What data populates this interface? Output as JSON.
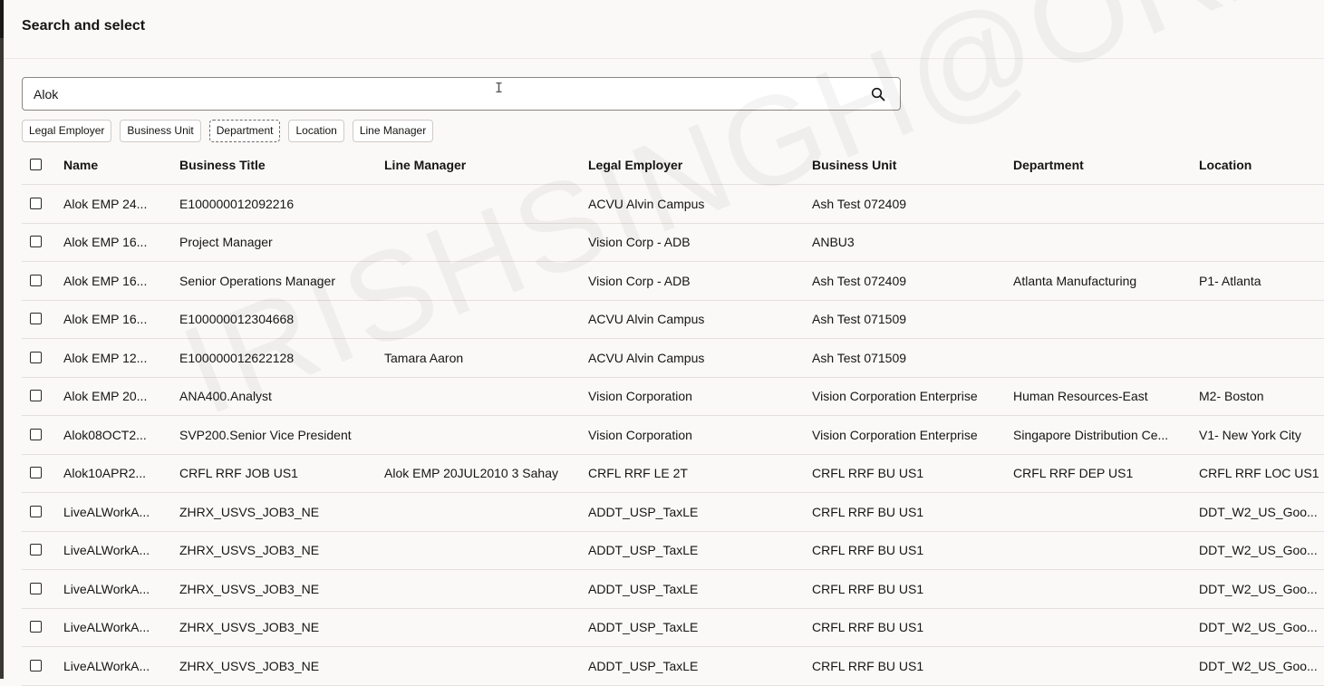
{
  "header": {
    "title": "Search and select"
  },
  "search": {
    "value": "Alok"
  },
  "filters": [
    "Legal Employer",
    "Business Unit",
    "Department",
    "Location",
    "Line Manager"
  ],
  "columns": [
    "Name",
    "Business Title",
    "Line Manager",
    "Legal Employer",
    "Business Unit",
    "Department",
    "Location"
  ],
  "rows": [
    [
      "Alok EMP 24...",
      "E100000012092216",
      "",
      "ACVU Alvin Campus",
      "Ash Test 072409",
      "",
      ""
    ],
    [
      "Alok EMP 16...",
      "Project Manager",
      "",
      "Vision Corp - ADB",
      "ANBU3",
      "",
      ""
    ],
    [
      "Alok EMP 16...",
      "Senior Operations Manager",
      "",
      "Vision Corp - ADB",
      "Ash Test 072409",
      "Atlanta Manufacturing",
      "P1- Atlanta"
    ],
    [
      "Alok EMP 16...",
      "E100000012304668",
      "",
      "ACVU Alvin Campus",
      "Ash Test 071509",
      "",
      ""
    ],
    [
      "Alok EMP 12...",
      "E100000012622128",
      "Tamara Aaron",
      "ACVU Alvin Campus",
      "Ash Test 071509",
      "",
      ""
    ],
    [
      "Alok EMP 20...",
      "ANA400.Analyst",
      "",
      "Vision Corporation",
      "Vision Corporation Enterprise",
      "Human Resources-East",
      "M2- Boston"
    ],
    [
      "Alok08OCT2...",
      "SVP200.Senior Vice President",
      "",
      "Vision Corporation",
      "Vision Corporation Enterprise",
      "Singapore Distribution Ce...",
      "V1- New York City"
    ],
    [
      "Alok10APR2...",
      "CRFL RRF JOB US1",
      "Alok EMP 20JUL2010 3 Sahay",
      "CRFL RRF LE 2T",
      "CRFL RRF BU US1",
      "CRFL RRF DEP US1",
      "CRFL RRF LOC US1"
    ],
    [
      "LiveALWorkA...",
      "ZHRX_USVS_JOB3_NE",
      "",
      "ADDT_USP_TaxLE",
      "CRFL RRF BU US1",
      "",
      "DDT_W2_US_Goo..."
    ],
    [
      "LiveALWorkA...",
      "ZHRX_USVS_JOB3_NE",
      "",
      "ADDT_USP_TaxLE",
      "CRFL RRF BU US1",
      "",
      "DDT_W2_US_Goo..."
    ],
    [
      "LiveALWorkA...",
      "ZHRX_USVS_JOB3_NE",
      "",
      "ADDT_USP_TaxLE",
      "CRFL RRF BU US1",
      "",
      "DDT_W2_US_Goo..."
    ],
    [
      "LiveALWorkA...",
      "ZHRX_USVS_JOB3_NE",
      "",
      "ADDT_USP_TaxLE",
      "CRFL RRF BU US1",
      "",
      "DDT_W2_US_Goo..."
    ],
    [
      "LiveALWorkA...",
      "ZHRX_USVS_JOB3_NE",
      "",
      "ADDT_USP_TaxLE",
      "CRFL RRF BU US1",
      "",
      "DDT_W2_US_Goo..."
    ]
  ],
  "watermark": "IRISHSINGH@ORACLE.COM",
  "icons": {
    "search": "search-icon",
    "cursor": "text-cursor-icon"
  },
  "colors": {
    "background": "#fbf9f8",
    "border": "#e4e0dc",
    "text": "#161513"
  }
}
